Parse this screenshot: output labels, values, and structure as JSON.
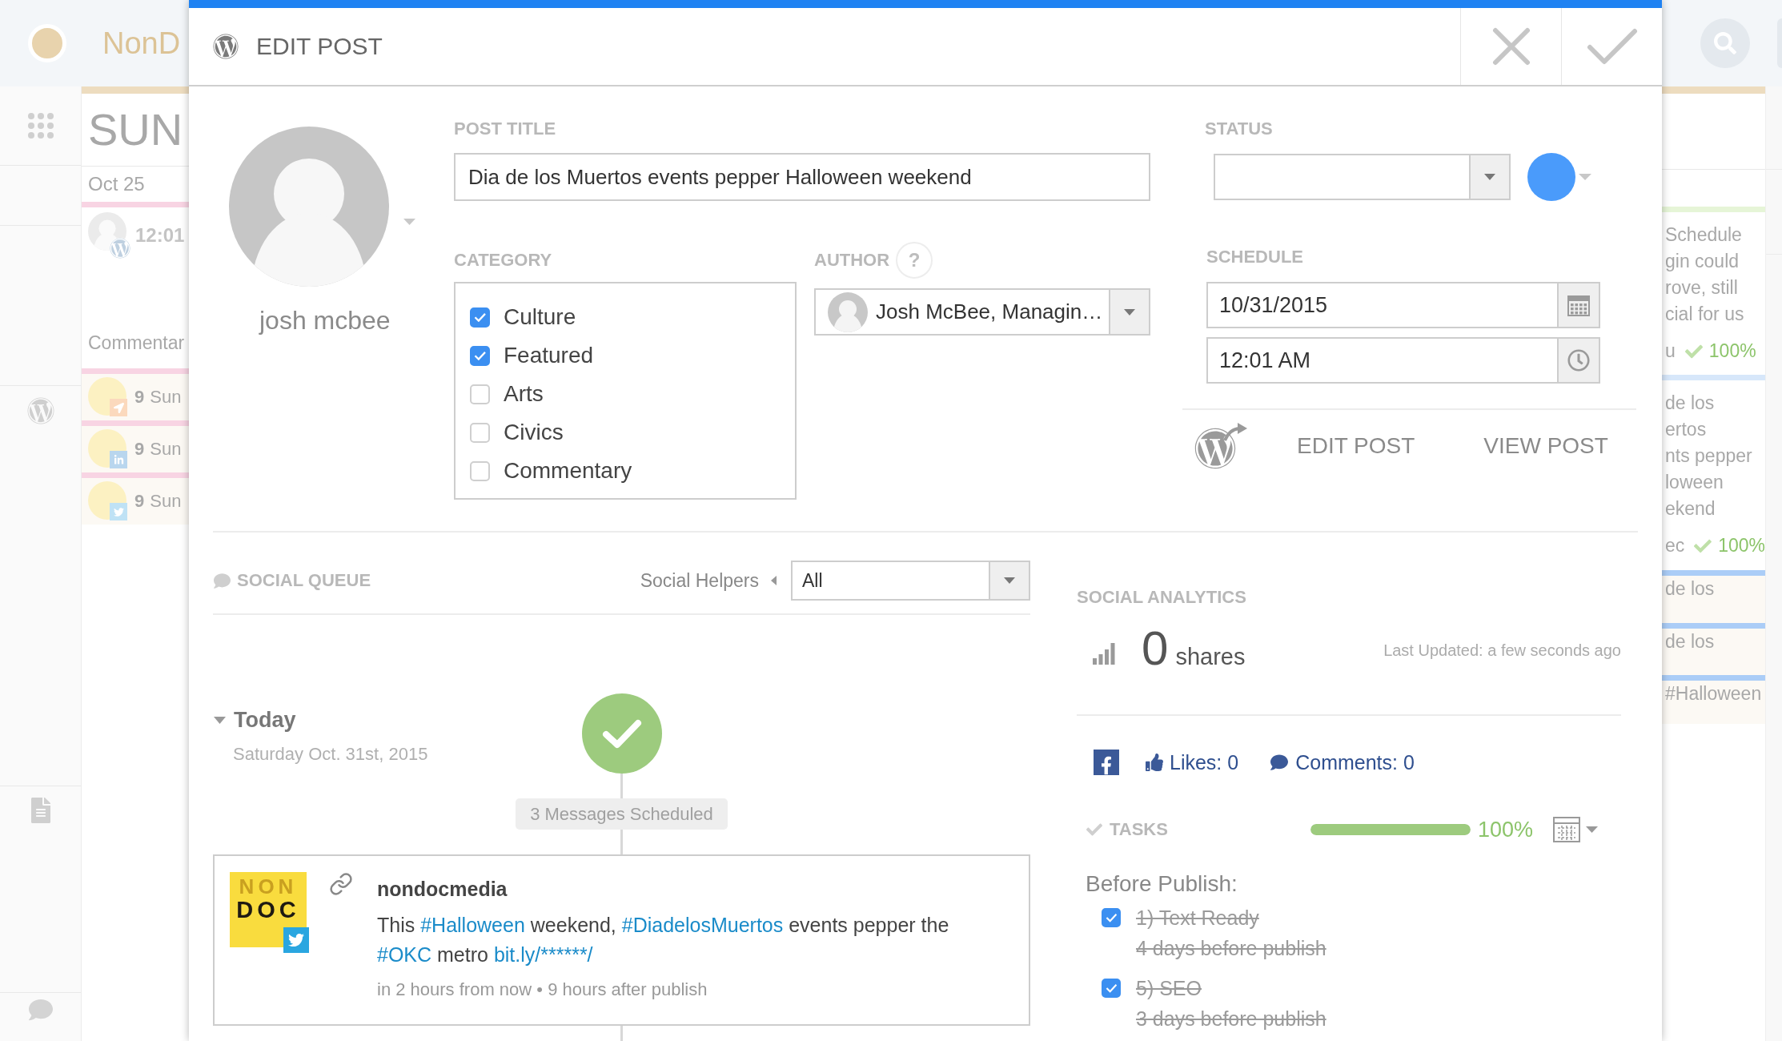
{
  "app_bar": {
    "logo_text": "NonD"
  },
  "calendar_left": {
    "day": "SUN",
    "date": "Oct 25",
    "post": {
      "color": "#f8d4e3",
      "time": "12:01",
      "category": "Commentar"
    },
    "social_posts": [
      {
        "kind": "send",
        "color": "#f8d4e3",
        "number": "9",
        "text": "Sun"
      },
      {
        "kind": "linkedin",
        "color": "#f8d4e3",
        "number": "9",
        "text": "Sun"
      },
      {
        "kind": "twitter",
        "color": "#f8d4e3",
        "number": "9",
        "text": "Sun"
      }
    ]
  },
  "calendar_right": {
    "posts": [
      {
        "color": "#e6f5d7",
        "lines": [
          "Schedule",
          "gin could",
          "rove, still",
          "cial for us"
        ],
        "footer": "u",
        "progress": "100%"
      },
      {
        "color": "#d7e7fa",
        "lines": [
          "de los",
          "ertos",
          "nts pepper",
          "loween",
          "ekend"
        ],
        "footer": "ec",
        "progress": "100%"
      }
    ],
    "social_posts": [
      {
        "color": "#abcdf7",
        "text": "de los"
      },
      {
        "color": "#abcdf7",
        "text": "de los"
      },
      {
        "color": "#abcdf7",
        "text": "#Halloween"
      }
    ]
  },
  "dialog": {
    "title": "EDIT POST",
    "author_name": "josh mcbee",
    "post_title": {
      "label": "POST TITLE",
      "value": "Dia de los Muertos events pepper Halloween weekend"
    },
    "category": {
      "label": "CATEGORY",
      "options": [
        {
          "label": "Culture",
          "checked": true
        },
        {
          "label": "Featured",
          "checked": true
        },
        {
          "label": "Arts",
          "checked": false
        },
        {
          "label": "Civics",
          "checked": false
        },
        {
          "label": "Commentary",
          "checked": false
        }
      ]
    },
    "author": {
      "label": "AUTHOR",
      "help": "?",
      "value": "Josh McBee, Managin…"
    },
    "status": {
      "label": "STATUS",
      "color": "#4a9bfb"
    },
    "schedule": {
      "label": "SCHEDULE",
      "date": "10/31/2015",
      "time": "12:01 AM"
    },
    "post_links": [
      "EDIT POST",
      "VIEW POST"
    ],
    "social_queue": {
      "title": "SOCIAL QUEUE",
      "helpers_label": "Social Helpers",
      "filter": "All",
      "day": {
        "title": "Today",
        "date": "Saturday Oct. 31st, 2015",
        "expanded": true,
        "scheduled": "3 Messages Scheduled",
        "messages": [
          {
            "kind": "twitter",
            "logo_text": [
              "NON",
              "DOC"
            ],
            "account": "nondocmedia",
            "text": [
              {
                "kind": "text",
                "text": "This "
              },
              {
                "kind": "hashtag",
                "text": "#Halloween"
              },
              {
                "kind": "text",
                "text": " weekend, "
              },
              {
                "kind": "hashtag",
                "text": "#DiadelosMuertos"
              },
              {
                "kind": "text",
                "text": " events pepper the "
              },
              {
                "kind": "hashtag",
                "text": "#OKC"
              },
              {
                "kind": "text",
                "text": " metro "
              },
              {
                "kind": "link",
                "text": "bit.ly/******/"
              }
            ],
            "meta": "in 2 hours from now • 9 hours after publish"
          }
        ]
      }
    },
    "social_analytics": {
      "title": "SOCIAL ANALYTICS",
      "count": "0",
      "unit": "shares",
      "updated": "Last Updated: a few seconds ago",
      "likes": "Likes: 0",
      "comments": "Comments: 0"
    },
    "tasks": {
      "title": "TASKS",
      "level": 1,
      "percent": "100%",
      "groups": [
        {
          "title": "Before Publish:",
          "items": [
            {
              "name": "1) Text Ready",
              "due": "4 days before publish",
              "checked": true
            },
            {
              "name": "5) SEO",
              "due": "3 days before publish",
              "checked": true
            }
          ]
        }
      ]
    }
  }
}
